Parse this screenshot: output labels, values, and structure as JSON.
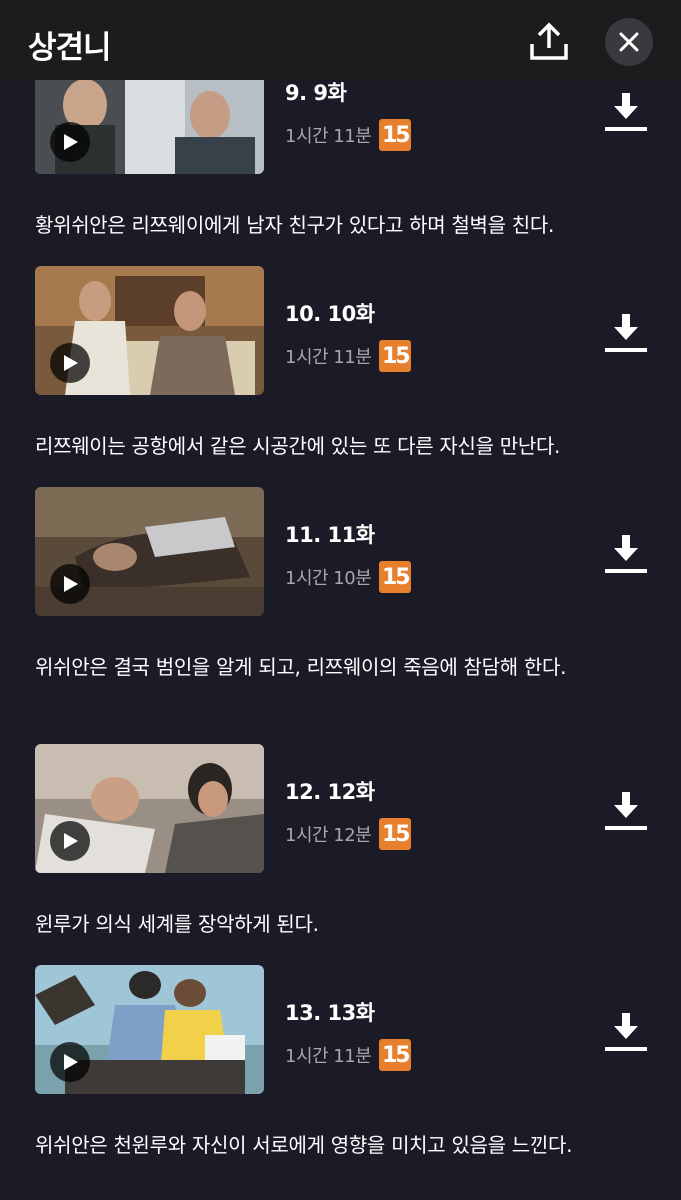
{
  "header": {
    "title": "상견니",
    "share_icon": "share-upload-icon",
    "close_icon": "close-icon"
  },
  "colors": {
    "background": "#1b1b27",
    "header_background": "#1c1c1e",
    "rating_badge": "#e87f2c",
    "meta_text": "#a6a6ae"
  },
  "episodes": [
    {
      "title": "9. 9화",
      "duration": "1시간 11분",
      "rating": "15",
      "description": "황위쉬안은 리쯔웨이에게 남자 친구가 있다고 하며 철벽을 친다."
    },
    {
      "title": "10. 10화",
      "duration": "1시간 11분",
      "rating": "15",
      "description": "리쯔웨이는 공항에서 같은 시공간에 있는 또 다른 자신을 만난다."
    },
    {
      "title": "11. 11화",
      "duration": "1시간 10분",
      "rating": "15",
      "description": "위쉬안은 결국 범인을 알게 되고, 리쯔웨이의 죽음에 참담해 한다."
    },
    {
      "title": "12. 12화",
      "duration": "1시간 12분",
      "rating": "15",
      "description": "윈루가 의식 세계를 장악하게 된다."
    },
    {
      "title": "13. 13화",
      "duration": "1시간 11분",
      "rating": "15",
      "description": "위쉬안은 천윈루와 자신이 서로에게 영향을 미치고 있음을 느낀다."
    }
  ]
}
